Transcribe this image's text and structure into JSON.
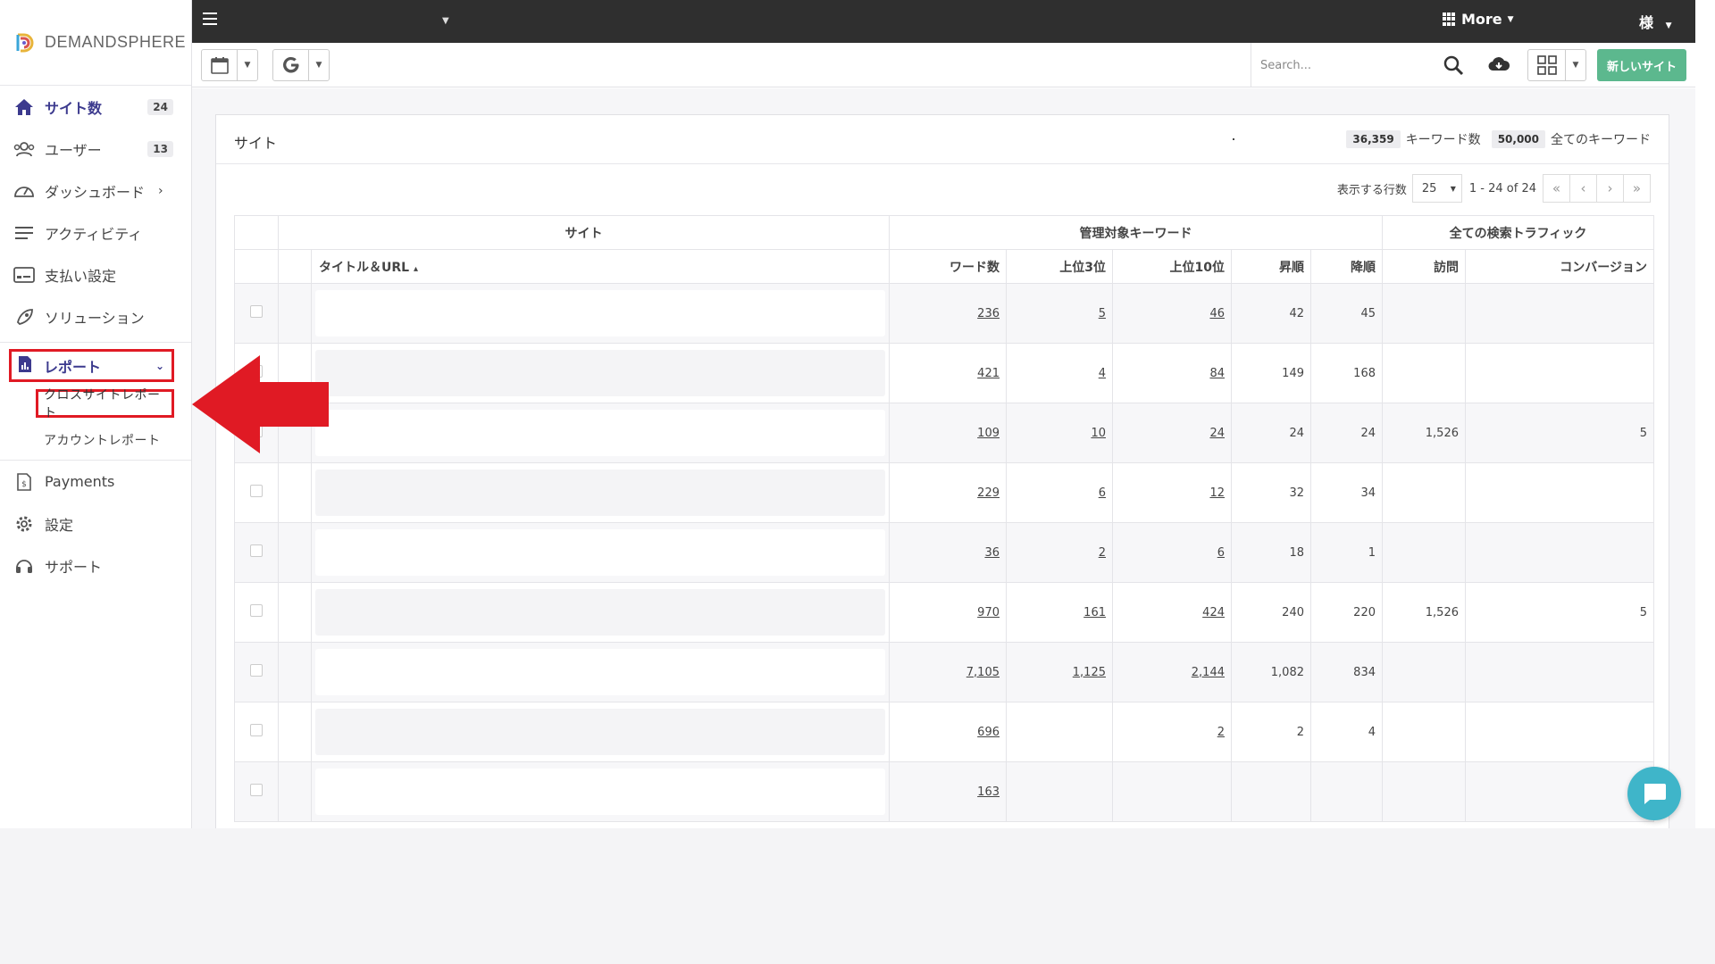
{
  "brand": {
    "name": "DEMANDSPHERE"
  },
  "sidebar": {
    "items": [
      {
        "label": "サイト数",
        "badge": "24",
        "icon": "home-icon"
      },
      {
        "label": "ユーザー",
        "badge": "13",
        "icon": "users-icon"
      },
      {
        "label": "ダッシュボード",
        "chevron": "›",
        "icon": "dashboard-icon"
      },
      {
        "label": "アクティビティ",
        "icon": "activity-icon"
      },
      {
        "label": "支払い設定",
        "icon": "billing-icon"
      },
      {
        "label": "ソリューション",
        "icon": "rocket-icon"
      },
      {
        "label": "レポート",
        "icon": "report-icon"
      },
      {
        "label": "Payments",
        "icon": "dollar-doc-icon"
      },
      {
        "label": "設定",
        "icon": "gear-icon"
      },
      {
        "label": "サポート",
        "icon": "support-icon"
      }
    ],
    "report_sub": [
      "クロスサイトレポート",
      "アカウントレポート"
    ]
  },
  "topbar": {
    "more": "More",
    "user": "様"
  },
  "toolbar": {
    "search_placeholder": "Search...",
    "new_site": "新しいサイト"
  },
  "card": {
    "title": "サイト",
    "keyword_count": "36,359",
    "keyword_label": "キーワード数",
    "keyword_total": "50,000",
    "keyword_total_label": "全てのキーワード"
  },
  "pager": {
    "rows_label": "表示する行数",
    "rows": "25",
    "range": "1 - 24 of 24"
  },
  "table": {
    "group_headers": [
      "サイト",
      "管理対象キーワード",
      "全ての検索トラフィック"
    ],
    "columns": [
      "タイトル＆URL",
      "ワード数",
      "上位3位",
      "上位10位",
      "昇順",
      "降順",
      "訪問",
      "コンバージョン"
    ],
    "sort_indicator": "▴",
    "rows": [
      {
        "words": "236",
        "top3": "5",
        "top10": "46",
        "up": "42",
        "down": "45",
        "visits": "",
        "conv": ""
      },
      {
        "words": "421",
        "top3": "4",
        "top10": "84",
        "up": "149",
        "down": "168",
        "visits": "",
        "conv": ""
      },
      {
        "words": "109",
        "top3": "10",
        "top10": "24",
        "up": "24",
        "down": "24",
        "visits": "1,526",
        "conv": "5"
      },
      {
        "words": "229",
        "top3": "6",
        "top10": "12",
        "up": "32",
        "down": "34",
        "visits": "",
        "conv": ""
      },
      {
        "words": "36",
        "top3": "2",
        "top10": "6",
        "up": "18",
        "down": "1",
        "visits": "",
        "conv": ""
      },
      {
        "words": "970",
        "top3": "161",
        "top10": "424",
        "up": "240",
        "down": "220",
        "visits": "1,526",
        "conv": "5"
      },
      {
        "words": "7,105",
        "top3": "1,125",
        "top10": "2,144",
        "up": "1,082",
        "down": "834",
        "visits": "",
        "conv": ""
      },
      {
        "words": "696",
        "top3": "",
        "top10": "2",
        "up": "2",
        "down": "4",
        "visits": "",
        "conv": ""
      },
      {
        "words": "163",
        "top3": "",
        "top10": "",
        "up": "",
        "down": "",
        "visits": "",
        "conv": ""
      }
    ]
  },
  "colors": {
    "accent": "#3c3a8e",
    "highlight": "#e01a24",
    "button": "#5cb88e",
    "chat": "#3fb5c9",
    "topbar": "#2f2f2f"
  }
}
